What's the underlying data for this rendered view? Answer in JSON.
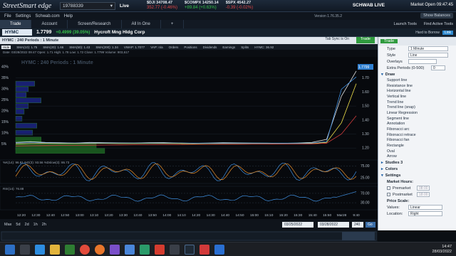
{
  "titlebar": {
    "app_name": "StreetSmart edge",
    "account": "19788339",
    "account_chevron": "▾",
    "status": "Live",
    "indices": [
      {
        "name": "$DJI",
        "value": "34708.47",
        "change": "352.77 (-0.46%)",
        "direction": "down"
      },
      {
        "name": "$COMPX",
        "value": "14250.14",
        "change": "+89.84 (+0.63%)",
        "direction": "up"
      },
      {
        "name": "$SPX",
        "value": "4542.27",
        "change": "-0.39 (-0.02%)",
        "direction": "down"
      }
    ],
    "brand": "SCHWAB LIVE",
    "market_status": "Market Open",
    "market_time": "09:47:45"
  },
  "menubar": {
    "items": [
      "File",
      "Settings",
      "Schwab.com",
      "Help"
    ],
    "version": "Version 1.76.35.2",
    "show_balances": "Show Balances"
  },
  "tabs": [
    {
      "label": "Trade",
      "active": true
    },
    {
      "label": "Account",
      "active": false
    },
    {
      "label": "Screen/Research",
      "active": false
    },
    {
      "label": "All In One",
      "active": false
    },
    {
      "label": "+",
      "active": false
    }
  ],
  "tools": [
    "Launch Tools",
    "Find Active Tools"
  ],
  "quote": {
    "symbol": "HYMC",
    "price": "1.7799",
    "change": "+0.4999 (39.05%)",
    "company": "Hycroft Mng Hldg Corp",
    "hard_to_borrow": "Hard to Borrow",
    "link": "Link"
  },
  "chart_window": {
    "title": "HYMC : 240 Periods : 1 Minute",
    "tab_sync": "Tab Sync is On",
    "trade_label": "Trade",
    "hide_label": "Hide",
    "studies": [
      "SMA(10): 1.75",
      "SMA(20): 1.66",
      "SMA(50): 1.43",
      "SMA(200): 1.34",
      "VWAP: 1.7077",
      "VAP: n/a",
      "Orders",
      "Positions",
      "Dividends",
      "Earnings",
      "Splits",
      "HYMC: 36.92"
    ],
    "date_line": "Date: 03/28/2022 09:47   Open: 1.71   High: 1.78   Low: 1.72   Close: 1.7799   Volume: 903,617",
    "watermark": "HYMC : 240 Periods : 1 Minute",
    "stoch_label": "%K(14): 96.91   %D(3): 93.56   %Dslow(3): 86.73",
    "rsi_label": "RSI(14): 76.88",
    "ranges": [
      "Max",
      "5d",
      "2d",
      "1h",
      "2h"
    ],
    "start_date": "03/25/2022",
    "end_date": "03/28/2022",
    "periods": "240",
    "go": "Go"
  },
  "chart_data": {
    "type": "line",
    "title": "HYMC : 240 Periods : 1 Minute",
    "x_ticks": [
      "12:20",
      "12:40",
      "13:00",
      "13:20",
      "13:40",
      "14:00",
      "14:20",
      "14:40",
      "15:00",
      "15:20",
      "15:40",
      "Mar28",
      "9:40"
    ],
    "x_ticks_full": [
      "12:20",
      "12:30",
      "12:40",
      "12:50",
      "13:00",
      "13:10",
      "13:20",
      "13:30",
      "13:40",
      "13:50",
      "14:00",
      "14:10",
      "14:20",
      "14:30",
      "14:40",
      "14:50",
      "15:00",
      "15:10",
      "15:20",
      "15:30",
      "15:40",
      "15:50",
      "Mar28",
      "9:40"
    ],
    "y_ticks": [
      1.2,
      1.3,
      1.4,
      1.5,
      1.6,
      1.7
    ],
    "ylim": [
      1.15,
      1.78
    ],
    "last_price": "1.7799",
    "vap_percent_ticks": [
      "5%",
      "10%",
      "15%",
      "20%",
      "25%",
      "30%",
      "35%",
      "40%"
    ],
    "vap_levels": [
      {
        "price": 1.66,
        "percent": 9
      },
      {
        "price": 1.62,
        "percent": 6
      },
      {
        "price": 1.58,
        "percent": 5
      },
      {
        "price": 1.54,
        "percent": 12
      },
      {
        "price": 1.5,
        "percent": 6
      },
      {
        "price": 1.46,
        "percent": 4
      },
      {
        "price": 1.41,
        "percent": 3
      },
      {
        "price": 1.36,
        "percent": 10
      },
      {
        "price": 1.31,
        "percent": 8
      },
      {
        "price": 1.26,
        "percent": 12
      },
      {
        "price": 1.21,
        "percent": 38
      },
      {
        "price": 1.18,
        "percent": 42
      }
    ],
    "series": [
      {
        "name": "SMA(10)",
        "color": "#e8e8e8",
        "values": [
          1.24,
          1.245,
          1.24,
          1.238,
          1.236,
          1.24,
          1.238,
          1.237,
          1.236,
          1.238,
          1.239,
          1.236,
          1.234,
          1.236,
          1.238,
          1.237,
          1.236,
          1.235,
          1.234,
          1.236,
          1.24,
          1.262,
          1.57,
          1.75
        ]
      },
      {
        "name": "SMA(20)",
        "color": "#f0e14a",
        "values": [
          1.23,
          1.232,
          1.233,
          1.232,
          1.232,
          1.233,
          1.233,
          1.232,
          1.232,
          1.233,
          1.233,
          1.232,
          1.231,
          1.232,
          1.232,
          1.232,
          1.232,
          1.232,
          1.231,
          1.232,
          1.233,
          1.24,
          1.38,
          1.66
        ]
      },
      {
        "name": "SMA(50)",
        "color": "#d43d3d",
        "values": [
          1.215,
          1.216,
          1.217,
          1.218,
          1.219,
          1.22,
          1.221,
          1.222,
          1.223,
          1.224,
          1.225,
          1.225,
          1.226,
          1.226,
          1.227,
          1.227,
          1.228,
          1.228,
          1.229,
          1.229,
          1.23,
          1.235,
          1.3,
          1.43
        ]
      },
      {
        "name": "VWAP",
        "color": "#3f8fe0",
        "values": [
          1.236,
          1.237,
          1.237,
          1.236,
          1.236,
          1.236,
          1.236,
          1.236,
          1.236,
          1.236,
          1.236,
          1.236,
          1.235,
          1.235,
          1.235,
          1.235,
          1.235,
          1.235,
          1.235,
          1.235,
          1.236,
          1.245,
          1.62,
          1.7077
        ]
      }
    ],
    "stochastic": {
      "levels": [
        25,
        75
      ],
      "ticks": [
        "25.00",
        "75.00"
      ],
      "k": 96.91,
      "d": 93.56,
      "dslow": 86.73
    },
    "rsi": {
      "levels": [
        30,
        70
      ],
      "ticks": [
        "30.00",
        "70.00"
      ],
      "value": 76.88
    }
  },
  "right_panel": {
    "trade": "Trade",
    "type_label": "Type",
    "type_value": "1 Minute",
    "style_label": "Style",
    "style_value": "Line",
    "overlays_label": "Overlays",
    "extra_label": "Extra Periods (0-500)",
    "extra_value": "0",
    "draw_label": "Draw",
    "draw_items": [
      "Support line",
      "Resistance line",
      "Horizontal line",
      "Vertical line",
      "Trend line",
      "Trend line (snap)",
      "Linear Regression",
      "Segment line",
      "Annotation",
      "Fibonacci arc",
      "Fibonacci retrace",
      "Fibonacci fan",
      "Rectangle",
      "Oval",
      "Arrow"
    ],
    "studies_label": "Studies",
    "studies_count": "3",
    "colors_label": "Colors",
    "settings_label": "Settings",
    "market_hours": "Market Hours:",
    "premarket": "Premarket",
    "premarket_time": "08:00",
    "postmarket": "Postmarket",
    "postmarket_time": "18:00",
    "price_scale": "Price Scale:",
    "values_label": "Values:",
    "values_value": "Linear",
    "location_label": "Location:",
    "location_value": "Right"
  },
  "taskbar": {
    "time": "14:47",
    "date": "28/03/2022"
  }
}
